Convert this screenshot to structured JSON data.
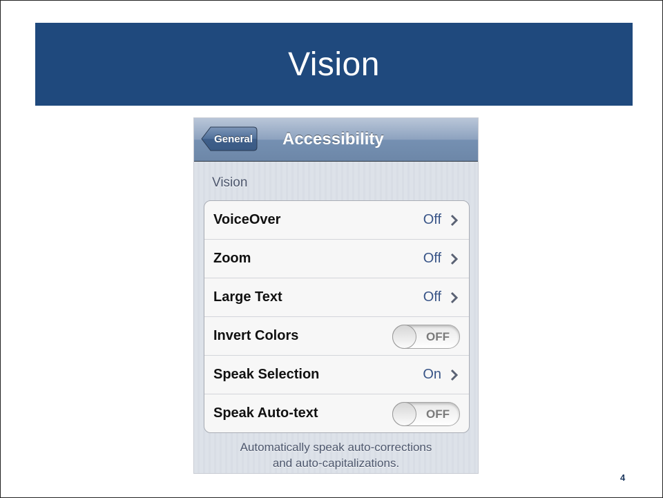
{
  "slide": {
    "title": "Vision",
    "page_number": "4"
  },
  "phone": {
    "navbar": {
      "back_label": "General",
      "title": "Accessibility"
    },
    "section_header": "Vision",
    "rows": [
      {
        "label": "VoiceOver",
        "value": "Off",
        "type": "disclosure"
      },
      {
        "label": "Zoom",
        "value": "Off",
        "type": "disclosure"
      },
      {
        "label": "Large Text",
        "value": "Off",
        "type": "disclosure"
      },
      {
        "label": "Invert Colors",
        "value": "OFF",
        "type": "toggle"
      },
      {
        "label": "Speak Selection",
        "value": "On",
        "type": "disclosure"
      },
      {
        "label": "Speak Auto-text",
        "value": "OFF",
        "type": "toggle"
      }
    ],
    "footnote": {
      "line1": "Automatically speak auto-corrections",
      "line2": "and auto-capitalizations."
    }
  },
  "colors": {
    "title_bar": "#1f497d",
    "value_text": "#385487",
    "navbar_accent": "#6d87a8"
  },
  "icons": {
    "chevron": "chevron-right-icon",
    "back": "back-arrow-button"
  }
}
